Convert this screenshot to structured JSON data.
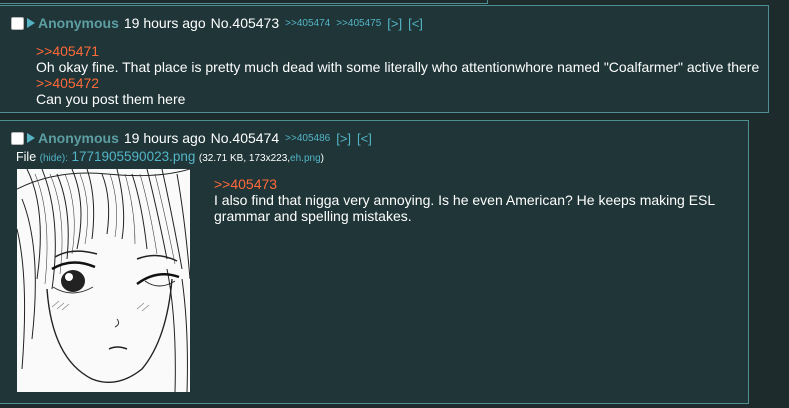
{
  "posts": [
    {
      "name": "Anonymous",
      "time": "19 hours ago",
      "number": "No.405473",
      "backlinks": [
        ">>405474",
        ">>405475"
      ],
      "nav_next": "[>]",
      "nav_prev": "[<]",
      "body": [
        {
          "type": "quote",
          "text": ">>405471"
        },
        {
          "type": "text",
          "text": "Oh okay fine. That place is pretty much dead with some literally who attentionwhore named \"Coalfarmer\" active there"
        },
        {
          "type": "quote",
          "text": ">>405472"
        },
        {
          "type": "text",
          "text": "Can you post them here"
        }
      ]
    },
    {
      "name": "Anonymous",
      "time": "19 hours ago",
      "number": "No.405474",
      "backlinks": [
        ">>405486"
      ],
      "nav_next": "[>]",
      "nav_prev": "[<]",
      "file": {
        "label": "File",
        "hide": "(hide):",
        "filename": "1771905590023.png",
        "meta_open": "(32.71 KB, 173x223,",
        "source_link": "eh.png",
        "meta_close": ")"
      },
      "body": [
        {
          "type": "quote",
          "text": ">>405473"
        },
        {
          "type": "text",
          "text": "I also find that nigga very annoying. Is he even American? He keeps making ESL"
        },
        {
          "type": "text",
          "text": "grammar and spelling mistakes."
        }
      ]
    }
  ],
  "colors": {
    "background": "#1d2b2c",
    "post_background": "#1f3537",
    "border": "#4f8f92",
    "name": "#5d9ea3",
    "link": "#53b5c7",
    "quote": "#ff6a3a"
  },
  "icons": {
    "select": "checkbox-icon",
    "expand": "triangle-right-icon"
  }
}
